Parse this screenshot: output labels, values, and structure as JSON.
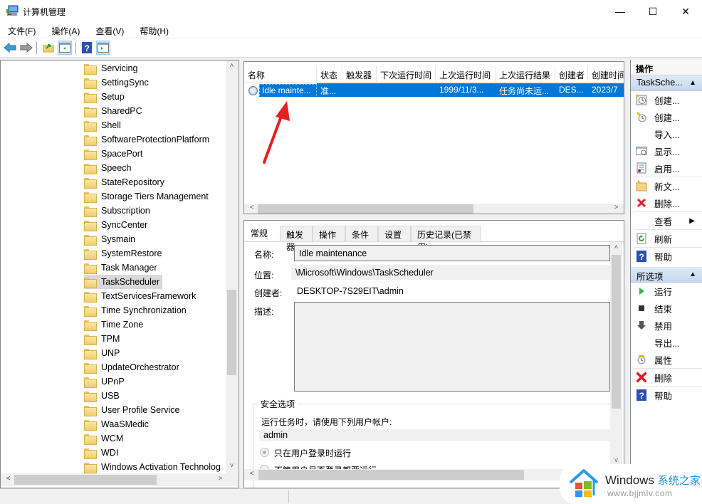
{
  "window": {
    "title": "计算机管理",
    "controls": {
      "minimize": "—",
      "maximize": "☐",
      "close": "✕"
    }
  },
  "menu": [
    "文件(F)",
    "操作(A)",
    "查看(V)",
    "帮助(H)"
  ],
  "toolbar": {
    "buttons": [
      "back-icon",
      "forward-icon",
      "up-folder-icon",
      "show-hide-tree-icon",
      "help-icon",
      "show-hide-action-pane-icon"
    ]
  },
  "tree": {
    "items": [
      "Servicing",
      "SettingSync",
      "Setup",
      "SharedPC",
      "Shell",
      "SoftwareProtectionPlatform",
      "SpacePort",
      "Speech",
      "StateRepository",
      "Storage Tiers Management",
      "Subscription",
      "SyncCenter",
      "Sysmain",
      "SystemRestore",
      "Task Manager",
      "TaskScheduler",
      "TextServicesFramework",
      "Time Synchronization",
      "Time Zone",
      "TPM",
      "UNP",
      "UpdateOrchestrator",
      "UPnP",
      "USB",
      "User Profile Service",
      "WaaSMedic",
      "WCM",
      "WDI",
      "Windows Activation Technolog"
    ],
    "selected": "TaskScheduler",
    "scroll_up": "˄",
    "scroll_down": "˅",
    "scroll_left": "<",
    "scroll_right": ">"
  },
  "task_list": {
    "columns": [
      "名称",
      "状态",
      "触发器",
      "下次运行时间",
      "上次运行时间",
      "上次运行结果",
      "创建者",
      "创建时间"
    ],
    "rows": [
      {
        "name": "Idle mainte...",
        "status": "准...",
        "trigger": "",
        "next_run": "",
        "last_run": "1999/11/3...",
        "last_result": "任务尚未运...",
        "author": "DES...",
        "created": "2023/7"
      }
    ],
    "scroll_left": "<",
    "scroll_right": ">"
  },
  "details": {
    "tabs": [
      "常规",
      "触发器",
      "操作",
      "条件",
      "设置",
      "历史记录(已禁用)"
    ],
    "active_tab": "常规",
    "name_label": "名称:",
    "name_value": "Idle maintenance",
    "location_label": "位置:",
    "location_value": "\\Microsoft\\Windows\\TaskScheduler",
    "author_label": "创建者:",
    "author_value": "DESKTOP-7S29EIT\\admin",
    "description_label": "描述:",
    "description_value": "",
    "security_group_title": "安全选项",
    "run_as_label": "运行任务时，请使用下列用户帐户:",
    "run_as_value": "admin",
    "radio_options": [
      {
        "label": "只在用户登录时运行",
        "checked": true
      },
      {
        "label": "不管用户是否登录都要运行",
        "checked": false
      }
    ],
    "scroll_up": "˄",
    "scroll_down": "˅",
    "scroll_left": "<"
  },
  "actions": {
    "header": "操作",
    "section1": {
      "title": "TaskSche...",
      "items": [
        {
          "label": "创建...",
          "icon": "create-basic-task-icon"
        },
        {
          "label": "创建...",
          "icon": "create-task-icon"
        },
        {
          "label": "导入...",
          "icon": ""
        },
        {
          "label": "显示...",
          "icon": "display-running-tasks-icon"
        },
        {
          "label": "启用...",
          "icon": "enable-history-icon"
        },
        {
          "label": "新文...",
          "icon": "new-folder-icon"
        },
        {
          "label": "删除...",
          "icon": "delete-folder-icon"
        },
        {
          "label": "查看",
          "icon": "",
          "submenu": "▶"
        },
        {
          "label": "刷新",
          "icon": "refresh-icon"
        },
        {
          "label": "帮助",
          "icon": "help-icon"
        }
      ]
    },
    "section2": {
      "title": "所选项",
      "items": [
        {
          "label": "运行",
          "icon": "run-icon"
        },
        {
          "label": "结束",
          "icon": "end-icon"
        },
        {
          "label": "禁用",
          "icon": "disable-icon"
        },
        {
          "label": "导出...",
          "icon": ""
        },
        {
          "label": "属性",
          "icon": "properties-icon"
        },
        {
          "label": "删除",
          "icon": "delete-icon"
        },
        {
          "label": "帮助",
          "icon": "help-icon"
        }
      ]
    },
    "collapse_glyph": "▲"
  },
  "watermark": {
    "brand": "Windows",
    "brand_cn": "系统之家",
    "url": "www.bjjmlv.com"
  },
  "colors": {
    "selection": "#0078d7",
    "action_section": "#c7d9ee",
    "annotation_arrow": "#e52020"
  }
}
